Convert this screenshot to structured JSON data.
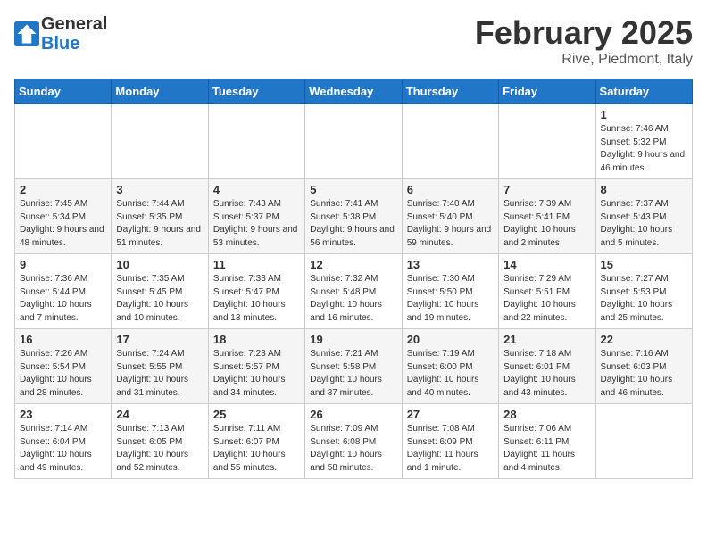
{
  "header": {
    "logo_general": "General",
    "logo_blue": "Blue",
    "month_title": "February 2025",
    "location": "Rive, Piedmont, Italy"
  },
  "weekdays": [
    "Sunday",
    "Monday",
    "Tuesday",
    "Wednesday",
    "Thursday",
    "Friday",
    "Saturday"
  ],
  "weeks": [
    [
      {
        "day": "",
        "info": ""
      },
      {
        "day": "",
        "info": ""
      },
      {
        "day": "",
        "info": ""
      },
      {
        "day": "",
        "info": ""
      },
      {
        "day": "",
        "info": ""
      },
      {
        "day": "",
        "info": ""
      },
      {
        "day": "1",
        "info": "Sunrise: 7:46 AM\nSunset: 5:32 PM\nDaylight: 9 hours and 46 minutes."
      }
    ],
    [
      {
        "day": "2",
        "info": "Sunrise: 7:45 AM\nSunset: 5:34 PM\nDaylight: 9 hours and 48 minutes."
      },
      {
        "day": "3",
        "info": "Sunrise: 7:44 AM\nSunset: 5:35 PM\nDaylight: 9 hours and 51 minutes."
      },
      {
        "day": "4",
        "info": "Sunrise: 7:43 AM\nSunset: 5:37 PM\nDaylight: 9 hours and 53 minutes."
      },
      {
        "day": "5",
        "info": "Sunrise: 7:41 AM\nSunset: 5:38 PM\nDaylight: 9 hours and 56 minutes."
      },
      {
        "day": "6",
        "info": "Sunrise: 7:40 AM\nSunset: 5:40 PM\nDaylight: 9 hours and 59 minutes."
      },
      {
        "day": "7",
        "info": "Sunrise: 7:39 AM\nSunset: 5:41 PM\nDaylight: 10 hours and 2 minutes."
      },
      {
        "day": "8",
        "info": "Sunrise: 7:37 AM\nSunset: 5:43 PM\nDaylight: 10 hours and 5 minutes."
      }
    ],
    [
      {
        "day": "9",
        "info": "Sunrise: 7:36 AM\nSunset: 5:44 PM\nDaylight: 10 hours and 7 minutes."
      },
      {
        "day": "10",
        "info": "Sunrise: 7:35 AM\nSunset: 5:45 PM\nDaylight: 10 hours and 10 minutes."
      },
      {
        "day": "11",
        "info": "Sunrise: 7:33 AM\nSunset: 5:47 PM\nDaylight: 10 hours and 13 minutes."
      },
      {
        "day": "12",
        "info": "Sunrise: 7:32 AM\nSunset: 5:48 PM\nDaylight: 10 hours and 16 minutes."
      },
      {
        "day": "13",
        "info": "Sunrise: 7:30 AM\nSunset: 5:50 PM\nDaylight: 10 hours and 19 minutes."
      },
      {
        "day": "14",
        "info": "Sunrise: 7:29 AM\nSunset: 5:51 PM\nDaylight: 10 hours and 22 minutes."
      },
      {
        "day": "15",
        "info": "Sunrise: 7:27 AM\nSunset: 5:53 PM\nDaylight: 10 hours and 25 minutes."
      }
    ],
    [
      {
        "day": "16",
        "info": "Sunrise: 7:26 AM\nSunset: 5:54 PM\nDaylight: 10 hours and 28 minutes."
      },
      {
        "day": "17",
        "info": "Sunrise: 7:24 AM\nSunset: 5:55 PM\nDaylight: 10 hours and 31 minutes."
      },
      {
        "day": "18",
        "info": "Sunrise: 7:23 AM\nSunset: 5:57 PM\nDaylight: 10 hours and 34 minutes."
      },
      {
        "day": "19",
        "info": "Sunrise: 7:21 AM\nSunset: 5:58 PM\nDaylight: 10 hours and 37 minutes."
      },
      {
        "day": "20",
        "info": "Sunrise: 7:19 AM\nSunset: 6:00 PM\nDaylight: 10 hours and 40 minutes."
      },
      {
        "day": "21",
        "info": "Sunrise: 7:18 AM\nSunset: 6:01 PM\nDaylight: 10 hours and 43 minutes."
      },
      {
        "day": "22",
        "info": "Sunrise: 7:16 AM\nSunset: 6:03 PM\nDaylight: 10 hours and 46 minutes."
      }
    ],
    [
      {
        "day": "23",
        "info": "Sunrise: 7:14 AM\nSunset: 6:04 PM\nDaylight: 10 hours and 49 minutes."
      },
      {
        "day": "24",
        "info": "Sunrise: 7:13 AM\nSunset: 6:05 PM\nDaylight: 10 hours and 52 minutes."
      },
      {
        "day": "25",
        "info": "Sunrise: 7:11 AM\nSunset: 6:07 PM\nDaylight: 10 hours and 55 minutes."
      },
      {
        "day": "26",
        "info": "Sunrise: 7:09 AM\nSunset: 6:08 PM\nDaylight: 10 hours and 58 minutes."
      },
      {
        "day": "27",
        "info": "Sunrise: 7:08 AM\nSunset: 6:09 PM\nDaylight: 11 hours and 1 minute."
      },
      {
        "day": "28",
        "info": "Sunrise: 7:06 AM\nSunset: 6:11 PM\nDaylight: 11 hours and 4 minutes."
      },
      {
        "day": "",
        "info": ""
      }
    ]
  ]
}
